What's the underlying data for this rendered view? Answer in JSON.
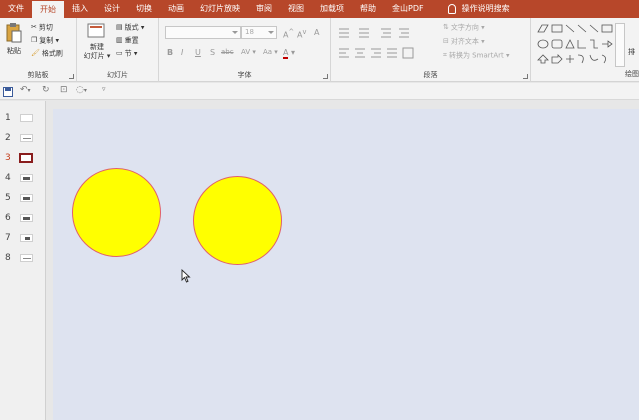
{
  "tabs": [
    {
      "label": "文件",
      "active": false
    },
    {
      "label": "开始",
      "active": true
    },
    {
      "label": "插入",
      "active": false
    },
    {
      "label": "设计",
      "active": false
    },
    {
      "label": "切换",
      "active": false
    },
    {
      "label": "动画",
      "active": false
    },
    {
      "label": "幻灯片放映",
      "active": false
    },
    {
      "label": "审阅",
      "active": false
    },
    {
      "label": "视图",
      "active": false
    },
    {
      "label": "加载项",
      "active": false
    },
    {
      "label": "帮助",
      "active": false
    },
    {
      "label": "金山PDF",
      "active": false
    }
  ],
  "tell_me": "操作说明搜索",
  "clipboard": {
    "label": "剪贴板",
    "paste": "粘贴",
    "cut": "剪切",
    "copy": "复制",
    "format_painter": "格式刷"
  },
  "slides_group": {
    "label": "幻灯片",
    "new_slide_line1": "新建",
    "new_slide_line2": "幻灯片",
    "layout": "版式",
    "reset": "重置",
    "section": "节"
  },
  "font_group": {
    "label": "字体",
    "font_name": "",
    "font_size": "18",
    "bold": "B",
    "italic": "I",
    "underline": "U",
    "shadow": "S",
    "strike": "abc",
    "spacing": "AV",
    "case": "Aa",
    "clear": "A",
    "color": "A",
    "grow": "A",
    "shrink": "A"
  },
  "paragraph_group": {
    "label": "段落",
    "text_direction": "文字方向",
    "align_text": "对齐文本",
    "smartart": "转换为 SmartArt"
  },
  "drawing_group": {
    "label": "绘图",
    "arrange": "排"
  },
  "qat": {
    "save": "save-icon",
    "undo": "undo-icon",
    "redo": "redo-icon"
  },
  "slides": [
    {
      "num": "1",
      "style": "blank"
    },
    {
      "num": "2",
      "style": "line"
    },
    {
      "num": "3",
      "style": "selected"
    },
    {
      "num": "4",
      "style": "dark"
    },
    {
      "num": "5",
      "style": "dark"
    },
    {
      "num": "6",
      "style": "dark"
    },
    {
      "num": "7",
      "style": "dark"
    },
    {
      "num": "8",
      "style": "line"
    }
  ],
  "active_slide": "3",
  "colors": {
    "accent": "#b7472a",
    "slide_bg": "#dee3f0",
    "circle_fill": "#ffff00",
    "circle_stroke": "#e0606a"
  }
}
